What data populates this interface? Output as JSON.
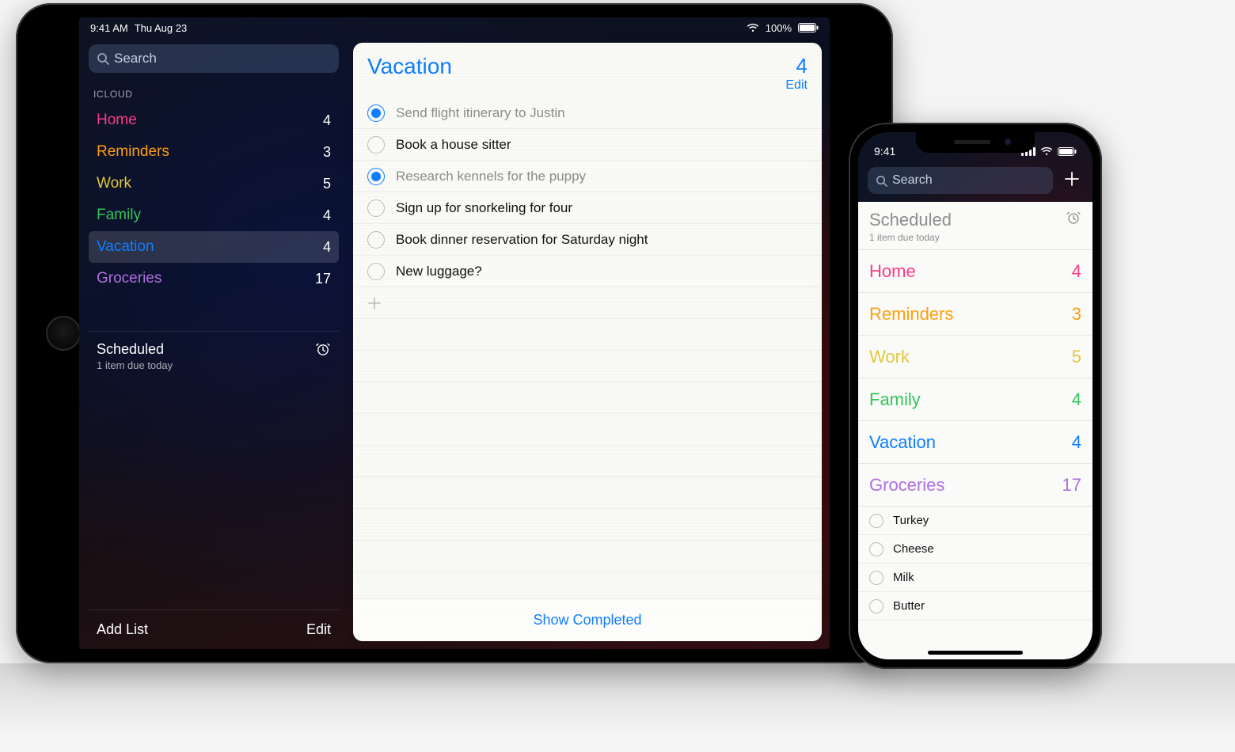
{
  "ipad": {
    "status": {
      "time": "9:41 AM",
      "date": "Thu Aug 23",
      "battery": "100%"
    },
    "search_placeholder": "Search",
    "section_label": "ICLOUD",
    "lists": [
      {
        "name": "Home",
        "count": 4,
        "color": "c-pink",
        "selected": false
      },
      {
        "name": "Reminders",
        "count": 3,
        "color": "c-orange",
        "selected": false
      },
      {
        "name": "Work",
        "count": 5,
        "color": "c-yellow",
        "selected": false
      },
      {
        "name": "Family",
        "count": 4,
        "color": "c-green",
        "selected": false
      },
      {
        "name": "Vacation",
        "count": 4,
        "color": "c-blue",
        "selected": true
      },
      {
        "name": "Groceries",
        "count": 17,
        "color": "c-purple",
        "selected": false
      }
    ],
    "scheduled": {
      "title": "Scheduled",
      "subtitle": "1 item due today"
    },
    "footer": {
      "add_list": "Add List",
      "edit": "Edit"
    },
    "detail": {
      "title": "Vacation",
      "count": 4,
      "edit": "Edit",
      "items": [
        {
          "text": "Send flight itinerary to Justin",
          "done": true
        },
        {
          "text": "Book a house sitter",
          "done": false
        },
        {
          "text": "Research kennels for the puppy",
          "done": true
        },
        {
          "text": "Sign up for snorkeling for four",
          "done": false
        },
        {
          "text": "Book dinner reservation for Saturday night",
          "done": false
        },
        {
          "text": "New luggage?",
          "done": false
        }
      ],
      "show_completed": "Show Completed"
    }
  },
  "iphone": {
    "status_time": "9:41",
    "search_placeholder": "Search",
    "scheduled": {
      "title": "Scheduled",
      "subtitle": "1 item due today"
    },
    "lists": [
      {
        "name": "Home",
        "count": 4,
        "color": "c-pink"
      },
      {
        "name": "Reminders",
        "count": 3,
        "color": "c-orange"
      },
      {
        "name": "Work",
        "count": 5,
        "color": "c-yellow"
      },
      {
        "name": "Family",
        "count": 4,
        "color": "c-green"
      },
      {
        "name": "Vacation",
        "count": 4,
        "color": "c-blue"
      },
      {
        "name": "Groceries",
        "count": 17,
        "color": "c-purple"
      }
    ],
    "groceries_items": [
      {
        "text": "Turkey"
      },
      {
        "text": "Cheese"
      },
      {
        "text": "Milk"
      },
      {
        "text": "Butter"
      }
    ]
  }
}
